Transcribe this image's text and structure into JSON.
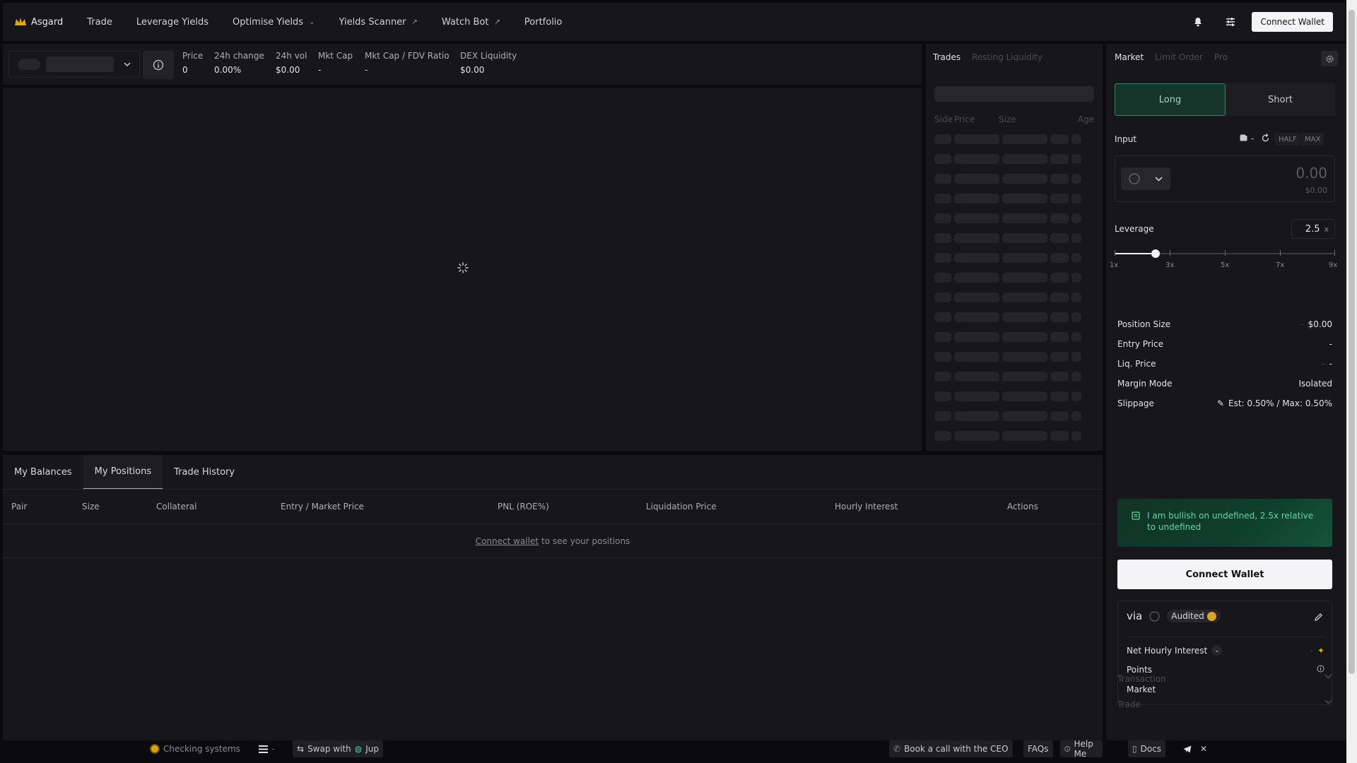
{
  "nav": {
    "brand": "Asgard",
    "items": [
      {
        "label": "Trade",
        "suffix": ""
      },
      {
        "label": "Leverage Yields",
        "suffix": ""
      },
      {
        "label": "Optimise Yields",
        "suffix": "⌄"
      },
      {
        "label": "Yields Scanner",
        "suffix": "↗"
      },
      {
        "label": "Watch Bot",
        "suffix": "↗"
      },
      {
        "label": "Portfolio",
        "suffix": ""
      }
    ],
    "connect_wallet": "Connect Wallet"
  },
  "market": {
    "stats": [
      {
        "key": "Price",
        "value": "0"
      },
      {
        "key": "24h change",
        "value": "0.00%"
      },
      {
        "key": "24h vol",
        "value": "$0.00"
      },
      {
        "key": "Mkt Cap",
        "value": "-"
      },
      {
        "key": "Mkt Cap / FDV Ratio",
        "value": "-"
      },
      {
        "key": "DEX Liquidity",
        "value": "$0.00"
      }
    ]
  },
  "trades": {
    "tabs": [
      "Trades",
      "Resting Liquidity"
    ],
    "headers": [
      "Side",
      "Price",
      "Size",
      "Age"
    ]
  },
  "order": {
    "tabs": [
      "Market",
      "Limit Order",
      "Pro"
    ],
    "long": "Long",
    "short": "Short",
    "input_label": "Input",
    "balance_dash": "-",
    "half": "HALF",
    "max": "MAX",
    "amount": "0.00",
    "amount_usd": "$0.00",
    "leverage_label": "Leverage",
    "leverage_value": "2.5",
    "leverage_unit": "x",
    "leverage_fraction": 0.1875,
    "leverage_ticks": [
      "1x",
      "3x",
      "5x",
      "7x",
      "9x"
    ],
    "details": [
      {
        "label": "Position Size",
        "pre": "-",
        "value": "$0.00"
      },
      {
        "label": "Entry Price",
        "pre": "",
        "value": "-"
      },
      {
        "label": "Liq. Price",
        "pre": "-",
        "value": "-"
      },
      {
        "label": "Margin Mode",
        "pre": "",
        "value": "Isolated"
      },
      {
        "label": "Slippage",
        "pre": "✎",
        "value": "Est: 0.50% / Max: 0.50%"
      }
    ],
    "bullish_text": "I am bullish on undefined, 2.5x relative to undefined",
    "connect_wallet": "Connect Wallet",
    "via": "via",
    "audited": "Audited",
    "via_rows": [
      {
        "label": "Net Hourly Interest",
        "value": "-"
      },
      {
        "label": "Points",
        "value": ""
      },
      {
        "label": "Market",
        "value": ""
      }
    ],
    "transaction": "Transaction",
    "trade": "Trade"
  },
  "positions": {
    "tabs": [
      "My Balances",
      "My Positions",
      "Trade History"
    ],
    "active_tab": 1,
    "headers": [
      "Pair",
      "Size",
      "Collateral",
      "Entry / Market Price",
      "PNL (ROE%)",
      "Liquidation Price",
      "Hourly Interest",
      "Actions"
    ],
    "empty_link": "Connect wallet",
    "empty_text": "to see your positions"
  },
  "footer": {
    "status": "Checking systems",
    "menu_dash": "-",
    "swap": "Swap with",
    "jup": "Jup",
    "ceo": "Book a call with the CEO",
    "faqs": "FAQs",
    "help": "Help Me",
    "docs": "Docs"
  }
}
